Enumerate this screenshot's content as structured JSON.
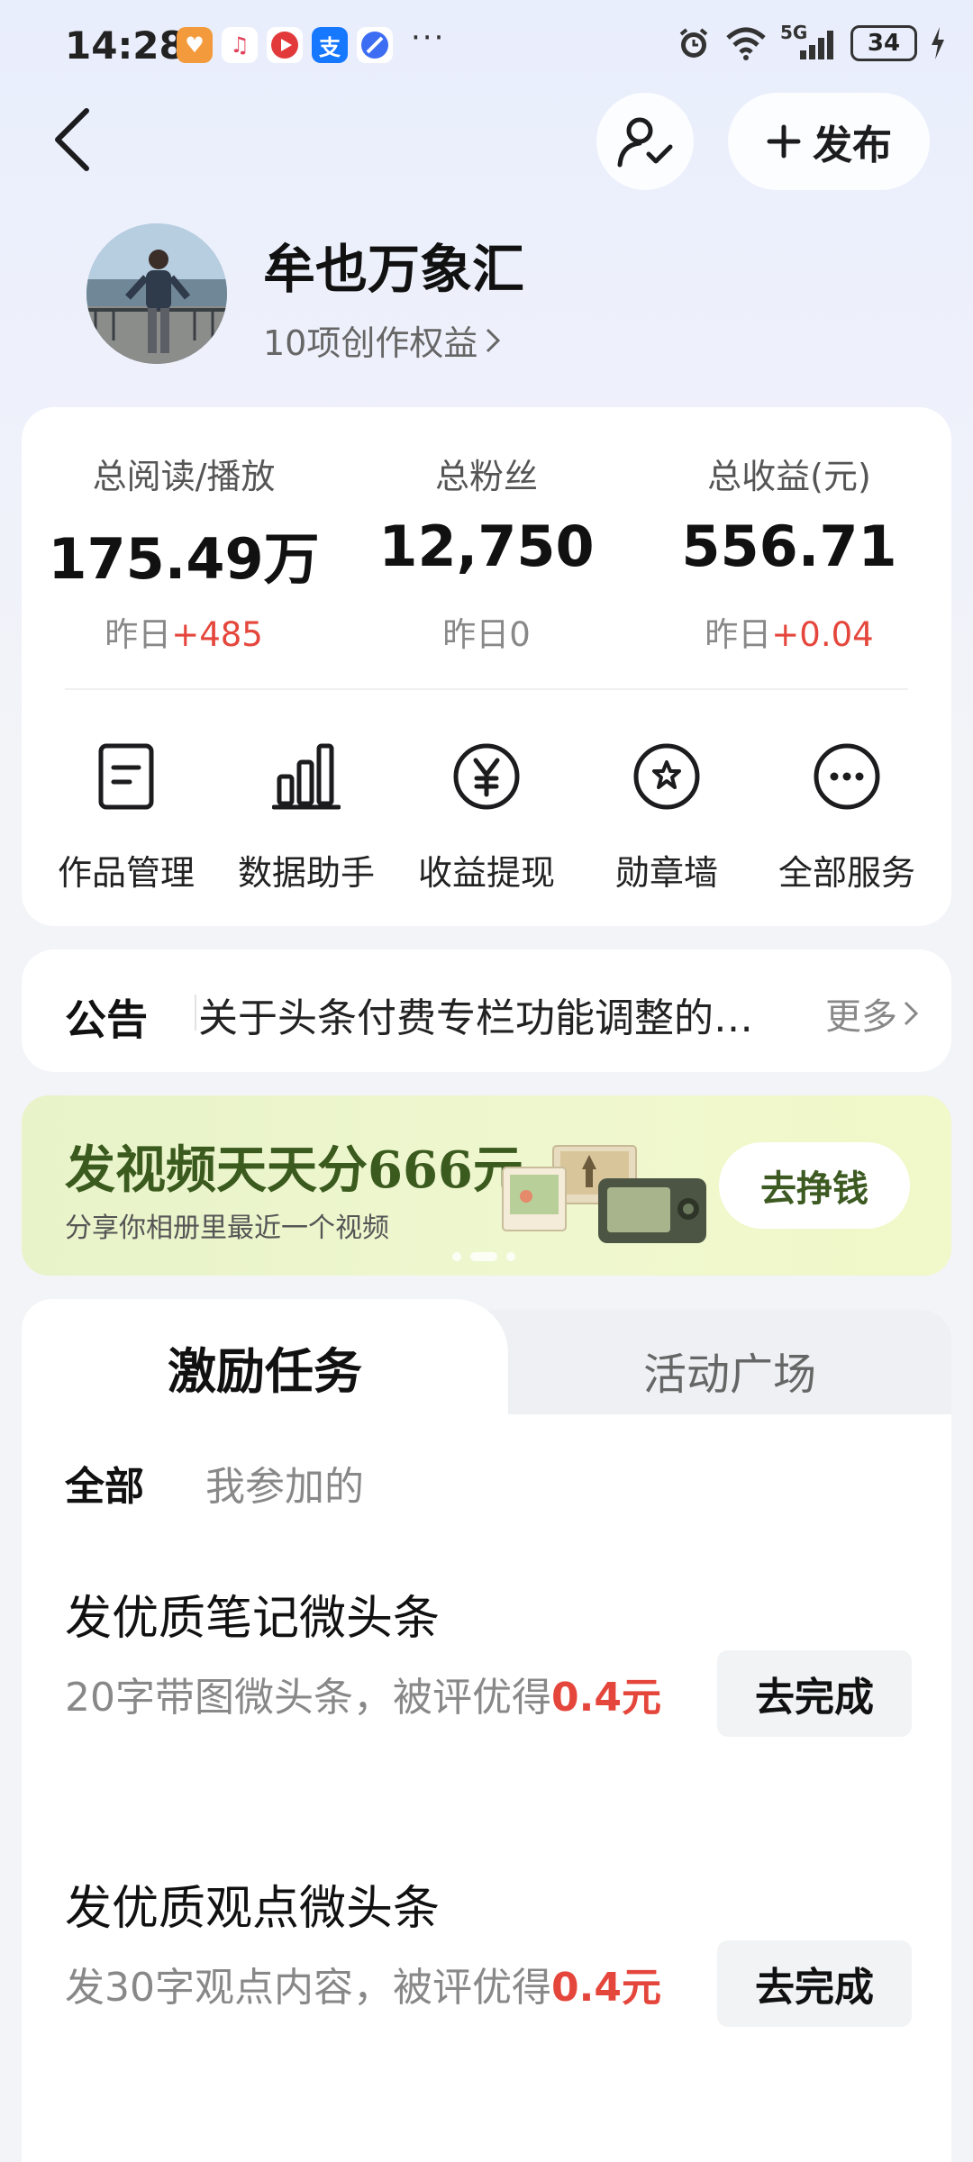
{
  "status_bar": {
    "time": "14:28",
    "more": "···",
    "network": "5G",
    "battery": "34"
  },
  "header": {
    "publish_label": "发布"
  },
  "profile": {
    "name": "牟也万象汇",
    "rights": "10项创作权益"
  },
  "stats": [
    {
      "label": "总阅读/播放",
      "value": "175.49万",
      "sub_prefix": "昨日",
      "sub_value": "+485"
    },
    {
      "label": "总粉丝",
      "value": "12,750",
      "sub_prefix": "昨日",
      "sub_value": "0"
    },
    {
      "label": "总收益(元)",
      "value": "556.71",
      "sub_prefix": "昨日",
      "sub_value": "+0.04"
    }
  ],
  "tools": [
    {
      "label": "作品管理",
      "icon": "document-icon"
    },
    {
      "label": "数据助手",
      "icon": "bar-chart-icon"
    },
    {
      "label": "收益提现",
      "icon": "yuan-coin-icon"
    },
    {
      "label": "勋章墙",
      "icon": "medal-icon"
    },
    {
      "label": "全部服务",
      "icon": "more-circle-icon"
    }
  ],
  "notice": {
    "title": "公告",
    "text": "关于头条付费专栏功能调整的说明",
    "more": "更多"
  },
  "banner": {
    "title": "发视频天天分666元",
    "subtitle": "分享你相册里最近一个视频",
    "button": "去挣钱"
  },
  "tasks": {
    "tabs": [
      "激励任务",
      "活动广场"
    ],
    "filters": [
      "全部",
      "我参加的"
    ],
    "items": [
      {
        "title": "发优质笔记微头条",
        "desc": "20字带图微头条，被评优得",
        "reward": "0.4元",
        "button": "去完成"
      },
      {
        "title": "发优质观点微头条",
        "desc": "发30字观点内容，被评优得",
        "reward": "0.4元",
        "button": "去完成"
      }
    ]
  },
  "colors": {
    "accent_red": "#e5463c",
    "banner_green": "#3b5a1e"
  }
}
